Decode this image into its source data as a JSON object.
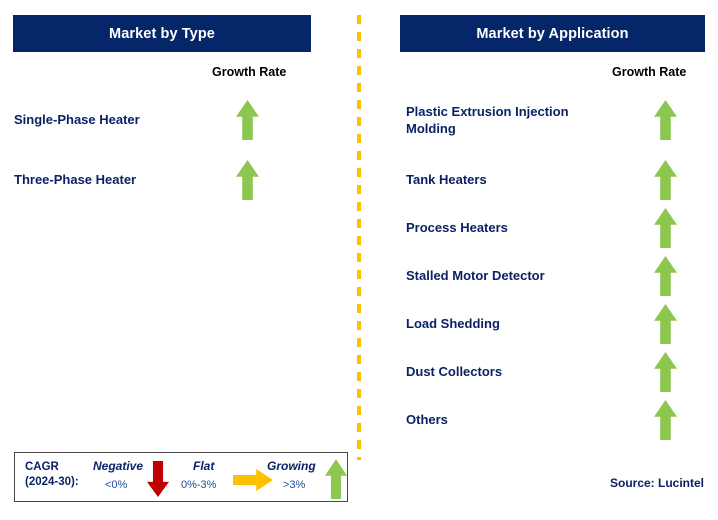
{
  "colors": {
    "header_navy": "#05276A",
    "label_navy": "#0B2265",
    "growth_green": "#8CC751",
    "negative_red": "#C00000",
    "flat_amber": "#FFC000",
    "divider_amber": "#FFC000"
  },
  "panels": [
    {
      "id": "market-by-type",
      "title": "Market by Type",
      "growth_rate_label": "Growth Rate",
      "rows": [
        {
          "label": "Single-Phase Heater",
          "growth": "growing",
          "icon": "arrow-up-icon"
        },
        {
          "label": "Three-Phase Heater",
          "growth": "growing",
          "icon": "arrow-up-icon"
        }
      ]
    },
    {
      "id": "market-by-application",
      "title": "Market by Application",
      "growth_rate_label": "Growth Rate",
      "rows": [
        {
          "label": "Plastic Extrusion Injection\nMolding",
          "growth": "growing",
          "icon": "arrow-up-icon"
        },
        {
          "label": "Tank Heaters",
          "growth": "growing",
          "icon": "arrow-up-icon"
        },
        {
          "label": "Process Heaters",
          "growth": "growing",
          "icon": "arrow-up-icon"
        },
        {
          "label": "Stalled Motor Detector",
          "growth": "growing",
          "icon": "arrow-up-icon"
        },
        {
          "label": "Load Shedding",
          "growth": "growing",
          "icon": "arrow-up-icon"
        },
        {
          "label": "Dust Collectors",
          "growth": "growing",
          "icon": "arrow-up-icon"
        },
        {
          "label": "Others",
          "growth": "growing",
          "icon": "arrow-up-icon"
        }
      ]
    }
  ],
  "legend": {
    "cagr_label": "CAGR\n(2024-30):",
    "items": [
      {
        "title": "Negative",
        "range": "<0%",
        "icon": "arrow-down-icon"
      },
      {
        "title": "Flat",
        "range": "0%-3%",
        "icon": "arrow-right-icon"
      },
      {
        "title": "Growing",
        "range": ">3%",
        "icon": "arrow-up-icon"
      }
    ]
  },
  "source": "Source: Lucintel"
}
